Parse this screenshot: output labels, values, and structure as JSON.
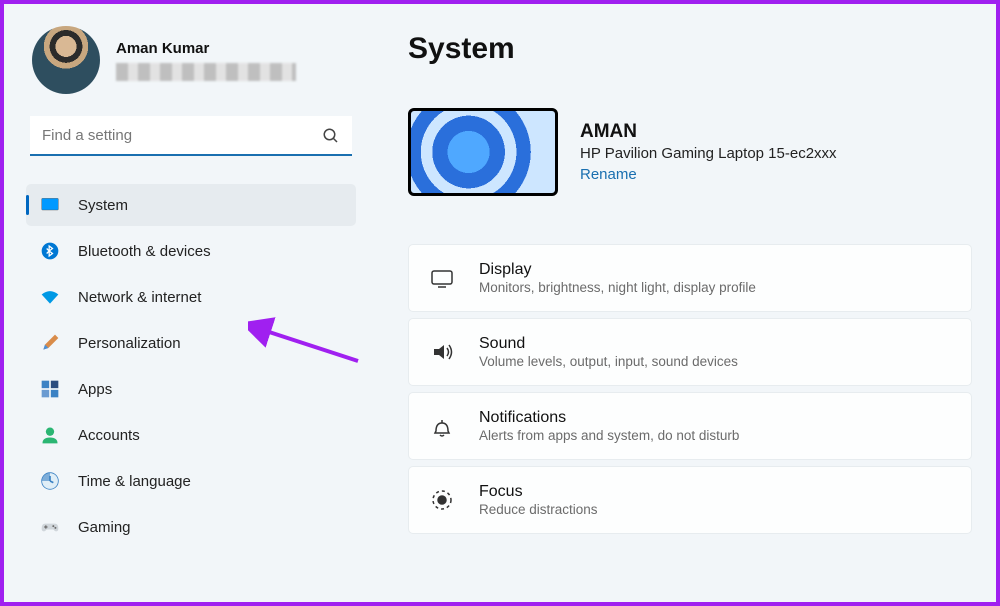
{
  "user": {
    "name": "Aman Kumar"
  },
  "search": {
    "placeholder": "Find a setting"
  },
  "nav": [
    {
      "label": "System",
      "icon": "system"
    },
    {
      "label": "Bluetooth & devices",
      "icon": "bluetooth"
    },
    {
      "label": "Network & internet",
      "icon": "wifi"
    },
    {
      "label": "Personalization",
      "icon": "brush"
    },
    {
      "label": "Apps",
      "icon": "apps"
    },
    {
      "label": "Accounts",
      "icon": "account"
    },
    {
      "label": "Time & language",
      "icon": "time"
    },
    {
      "label": "Gaming",
      "icon": "gaming"
    }
  ],
  "page": {
    "title": "System"
  },
  "device": {
    "name": "AMAN",
    "model": "HP Pavilion Gaming Laptop 15-ec2xxx",
    "rename": "Rename"
  },
  "settings": [
    {
      "title": "Display",
      "sub": "Monitors, brightness, night light, display profile",
      "icon": "display"
    },
    {
      "title": "Sound",
      "sub": "Volume levels, output, input, sound devices",
      "icon": "sound"
    },
    {
      "title": "Notifications",
      "sub": "Alerts from apps and system, do not disturb",
      "icon": "bell"
    },
    {
      "title": "Focus",
      "sub": "Reduce distractions",
      "icon": "focus"
    }
  ],
  "colors": {
    "accent": "#0067c0",
    "link": "#1a6fb0",
    "annotation": "#a020f0"
  }
}
